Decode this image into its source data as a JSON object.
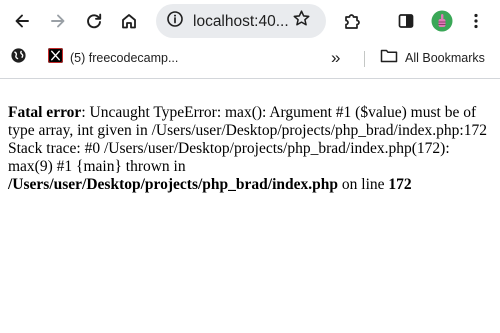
{
  "browser": {
    "url_text": "localhost:40...",
    "colors": {
      "toolbar_bg": "#ffffff",
      "omnibox_bg": "#e9ebee",
      "icon": "#1f1f1f",
      "icon_disabled": "#9aa0a6",
      "avatar_bg": "#3aa757"
    },
    "toolbar_icons": [
      "back-arrow-icon",
      "forward-arrow-icon",
      "reload-icon",
      "home-icon",
      "site-info-icon",
      "star-icon",
      "extensions-puzzle-icon",
      "side-panel-icon",
      "profile-avatar-icon",
      "more-vert-icon"
    ]
  },
  "bookmarks": {
    "items": [
      {
        "icon": "globe-icon",
        "label": ""
      },
      {
        "icon": "x-logo-icon",
        "label": "(5) freecodecamp..."
      }
    ],
    "overflow_label": "»",
    "all_bookmarks_label": "All Bookmarks"
  },
  "error": {
    "prefix": "Fatal error",
    "colon": ": ",
    "message": "Uncaught TypeError: max(): Argument #1 ($value) must be of type array, int given in /Users/user/Desktop/projects/php_brad/index.php:172 Stack trace: #0 /Users/user/Desktop/projects/php_brad/index.php(172): max(9) #1 {main} thrown in ",
    "file": "/Users/user/Desktop/projects/php_brad/index.php",
    "on_line_text": " on line ",
    "line": "172"
  }
}
